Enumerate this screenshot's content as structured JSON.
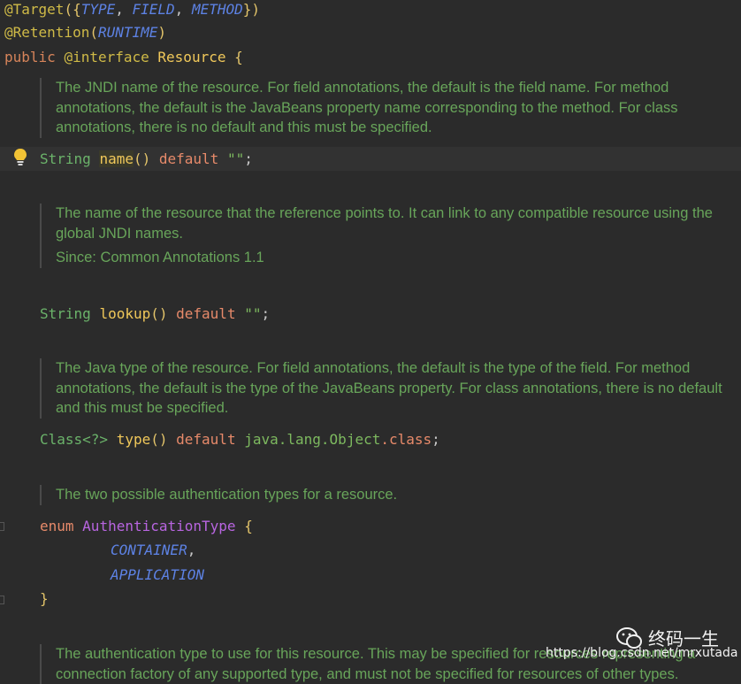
{
  "code": {
    "target_annotation": "@Target",
    "target_values": [
      "TYPE",
      "FIELD",
      "METHOD"
    ],
    "retention_annotation": "@Retention",
    "retention_value": "RUNTIME",
    "public_kw": "public",
    "interface_kw": "@interface",
    "interface_name": "Resource",
    "open_brace": "{",
    "doc_name": "The JNDI name of the resource. For field annotations, the default is the field name. For method annotations, the default is the JavaBeans property name corresponding to the method. For class annotations, there is no default and this must be specified.",
    "name_type": "String",
    "name_method": "name",
    "default_kw": "default",
    "empty_string": "\"\"",
    "doc_lookup": "The name of the resource that the reference points to. It can link to any compatible resource using the global JNDI names.",
    "doc_lookup_since": "Since: Common Annotations 1.1",
    "lookup_type": "String",
    "lookup_method": "lookup",
    "doc_type": "The Java type of the resource. For field annotations, the default is the type of the field. For method annotations, the default is the type of the JavaBeans property. For class annotations, there is no default and this must be specified.",
    "type_type": "Class<?>",
    "type_method": "type",
    "type_default_pkg": "java.lang.Object",
    "type_default_cls": ".class",
    "doc_auth": "The two possible authentication types for a resource.",
    "enum_kw": "enum",
    "enum_name": "AuthenticationType",
    "enum_constants": [
      "CONTAINER",
      "APPLICATION"
    ],
    "close_brace": "}",
    "doc_auth_type": "The authentication type to use for this resource. This may be specified for resources representing a connection factory of any supported type, and must not be specified for resources of other types."
  },
  "watermark": {
    "name": "终码一生",
    "url": "https://blog.csdn.net/mrxutada"
  },
  "colors": {
    "background": "#2b2b2b",
    "doc_text": "#68a55a",
    "annotation": "#cfba47",
    "enum_constant": "#5d82e4",
    "purple": "#b865e0"
  }
}
